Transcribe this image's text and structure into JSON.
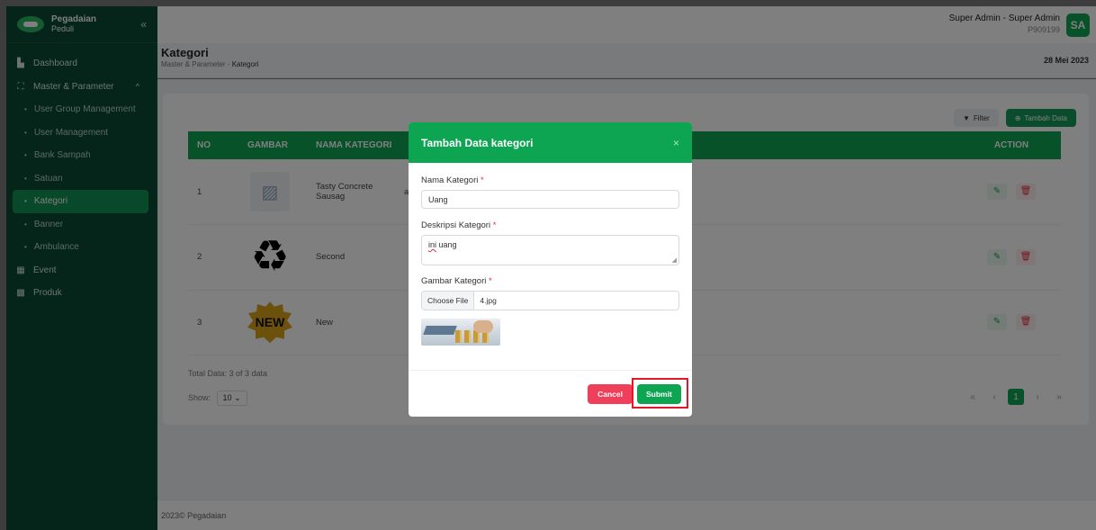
{
  "brand": {
    "name": "Pegadaian",
    "sub": "Peduli",
    "collapse": "«"
  },
  "sidebar": {
    "items": [
      {
        "label": "Dashboard",
        "icon": "▙"
      },
      {
        "label": "Master & Parameter",
        "icon": "⛶",
        "caret": "^"
      },
      {
        "label": "User Group Management"
      },
      {
        "label": "User Management"
      },
      {
        "label": "Bank Sampah"
      },
      {
        "label": "Satuan"
      },
      {
        "label": "Kategori"
      },
      {
        "label": "Banner"
      },
      {
        "label": "Ambulance"
      },
      {
        "label": "Event",
        "icon": "▦"
      },
      {
        "label": "Produk",
        "icon": "▩"
      }
    ]
  },
  "topbar": {
    "user_name": "Super Admin - Super Admin",
    "user_id": "P909199",
    "avatar": "SA"
  },
  "page": {
    "title": "Kategori",
    "crumb_parent": "Master & Parameter",
    "crumb_sep": "-",
    "crumb_current": "Kategori",
    "date": "28 Mei 2023"
  },
  "toolbar": {
    "filter": "Filter",
    "add": "Tambah Data"
  },
  "table": {
    "headers": {
      "no": "NO",
      "image": "GAMBAR",
      "name": "NAMA KATEGORI",
      "action": "ACTION"
    },
    "rows": [
      {
        "no": "1",
        "name": "Tasty Concrete Sausag",
        "desc": "ates. Ex iusto provident adipisci."
      },
      {
        "no": "2",
        "name": "Second",
        "desc": ""
      },
      {
        "no": "3",
        "name": "New",
        "desc": ""
      }
    ],
    "new_badge": "NEW"
  },
  "summary": {
    "total": "Total Data: 3 of 3 data",
    "show_label": "Show:",
    "show_value": "10"
  },
  "pagination": {
    "first": "«",
    "prev": "‹",
    "current": "1",
    "next": "›",
    "last": "»"
  },
  "footer": {
    "text": "2023© Pegadaian"
  },
  "modal": {
    "title": "Tambah Data kategori",
    "close": "×",
    "name_label": "Nama Kategori",
    "name_value": "Uang",
    "desc_label": "Deskripsi Kategori",
    "desc_word1": "ini",
    "desc_word2": " uang",
    "image_label": "Gambar Kategori",
    "choose_file": "Choose File",
    "file_name": "4.jpg",
    "required_mark": "*",
    "cancel": "Cancel",
    "submit": "Submit"
  },
  "colors": {
    "primary": "#0ea552",
    "sidebar_bg": "#0a4a35",
    "danger": "#ef3f5a",
    "highlight": "#e1182a"
  }
}
